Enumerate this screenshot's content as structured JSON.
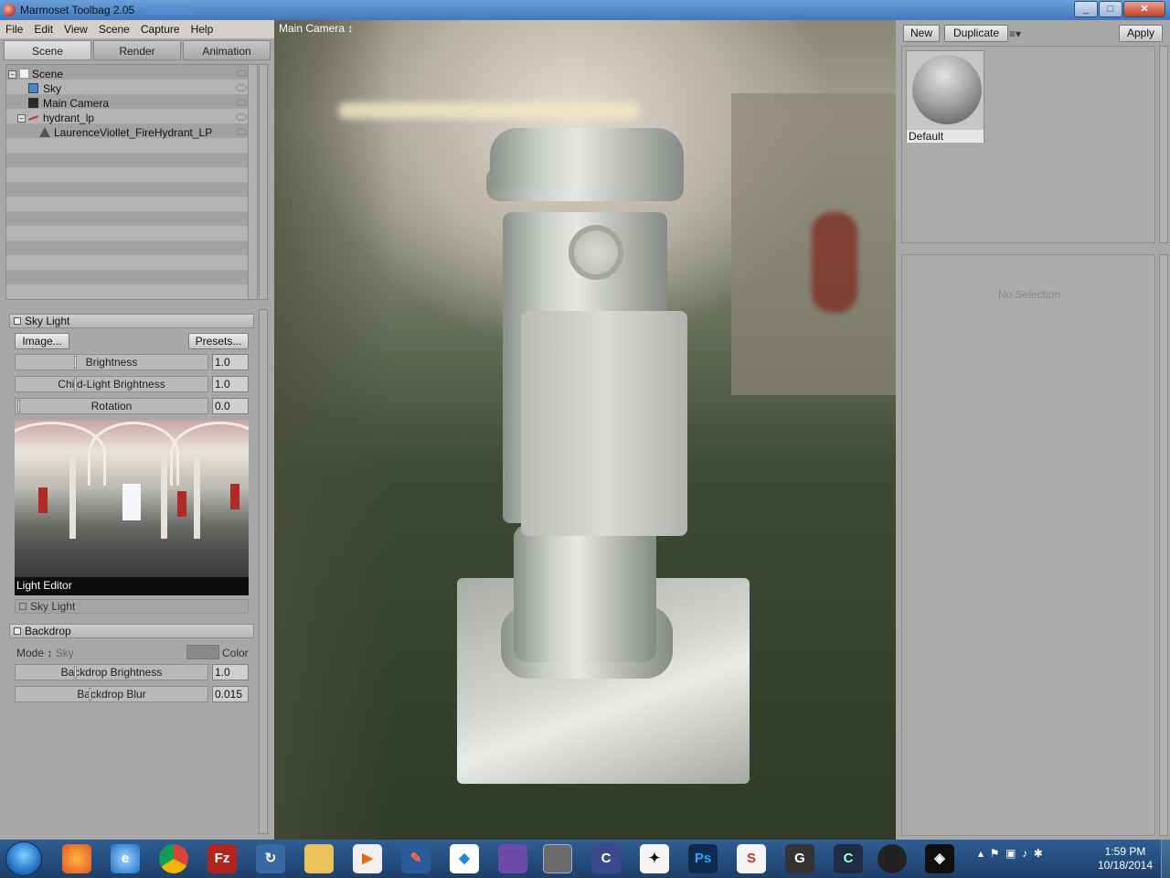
{
  "window": {
    "title": "Marmoset Toolbag 2.05"
  },
  "menu": [
    "File",
    "Edit",
    "View",
    "Scene",
    "Capture",
    "Help"
  ],
  "left_tabs": [
    "Scene",
    "Render",
    "Animation"
  ],
  "scene_tree": [
    {
      "label": "Scene"
    },
    {
      "label": "Sky"
    },
    {
      "label": "Main Camera"
    },
    {
      "label": "hydrant_lp"
    },
    {
      "label": "LaurenceViollet_FireHydrant_LP"
    }
  ],
  "sky_light": {
    "title": "Sky Light",
    "image_button": "Image...",
    "presets_button": "Presets...",
    "brightness_label": "Brightness",
    "brightness_value": "1.0",
    "child_light_label": "Child-Light Brightness",
    "child_light_value": "1.0",
    "rotation_label": "Rotation",
    "rotation_value": "0.0",
    "preview_caption": "Light Editor",
    "sub_section": "Sky Light"
  },
  "backdrop": {
    "title": "Backdrop",
    "mode_label": "Mode",
    "mode_value": "Sky",
    "color_label": "Color",
    "brightness_label": "Backdrop Brightness",
    "brightness_value": "1.0",
    "blur_label": "Backdrop Blur",
    "blur_value": "0.015"
  },
  "viewport": {
    "camera": "Main Camera"
  },
  "material_panel": {
    "new_button": "New",
    "duplicate_button": "Duplicate",
    "apply_button": "Apply",
    "material_name": "Default",
    "no_selection": "No Selection"
  },
  "taskbar": {
    "time": "1:59 PM",
    "date": "10/18/2014"
  },
  "colors": {
    "titlebar": "#3f78bd",
    "panel_bg": "#a8a8a8",
    "taskbar": "#1d3f6a"
  }
}
